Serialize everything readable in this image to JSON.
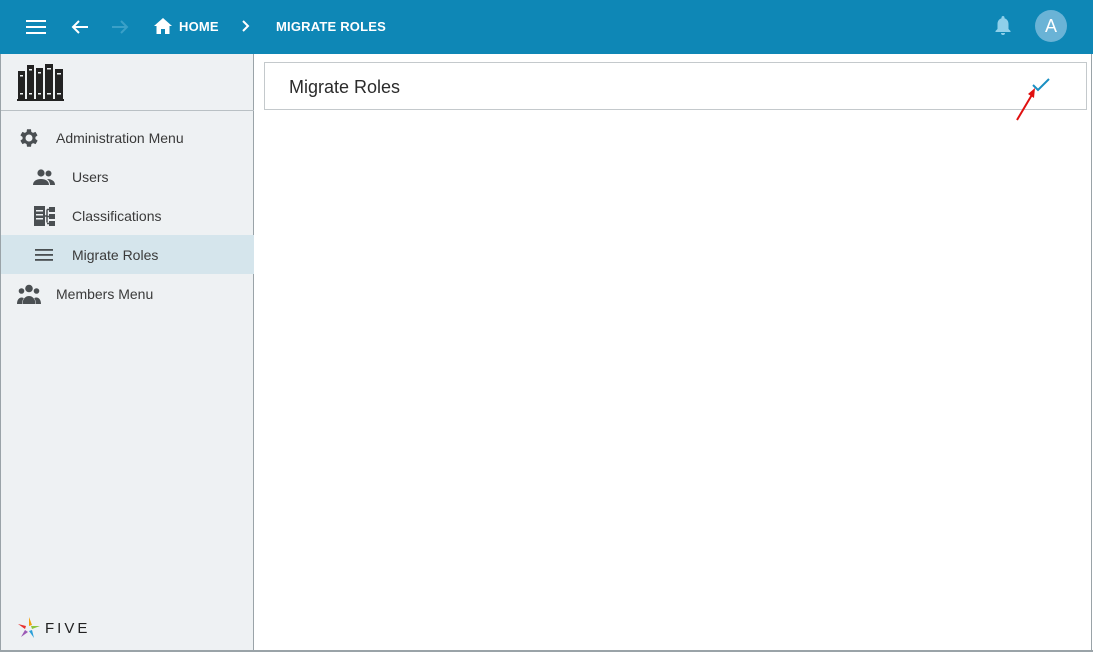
{
  "appbar": {
    "breadcrumb_home": "HOME",
    "breadcrumb_current": "MIGRATE ROLES",
    "avatar_letter": "A",
    "icons": [
      "hamburger-menu-icon",
      "back-arrow-icon",
      "forward-arrow-icon",
      "home-icon",
      "chevron-right-icon",
      "bell-icon"
    ]
  },
  "sidebar": {
    "items": [
      {
        "label": "Administration Menu",
        "icon": "gear-icon"
      },
      {
        "label": "Users",
        "icon": "users-icon"
      },
      {
        "label": "Classifications",
        "icon": "hierarchy-icon"
      },
      {
        "label": "Migrate Roles",
        "icon": "list-icon",
        "selected": true
      },
      {
        "label": "Members Menu",
        "icon": "group-icon"
      }
    ],
    "brand_text": "FIVE"
  },
  "main": {
    "panel_title": "Migrate Roles",
    "confirm_icon": "check-icon"
  },
  "colors": {
    "appbar": "#0e87b6",
    "sidebar_bg": "#eef1f3",
    "selected_bg": "#d5e5ec",
    "accent": "#1a8fc2",
    "annotation_arrow": "#e01010"
  }
}
